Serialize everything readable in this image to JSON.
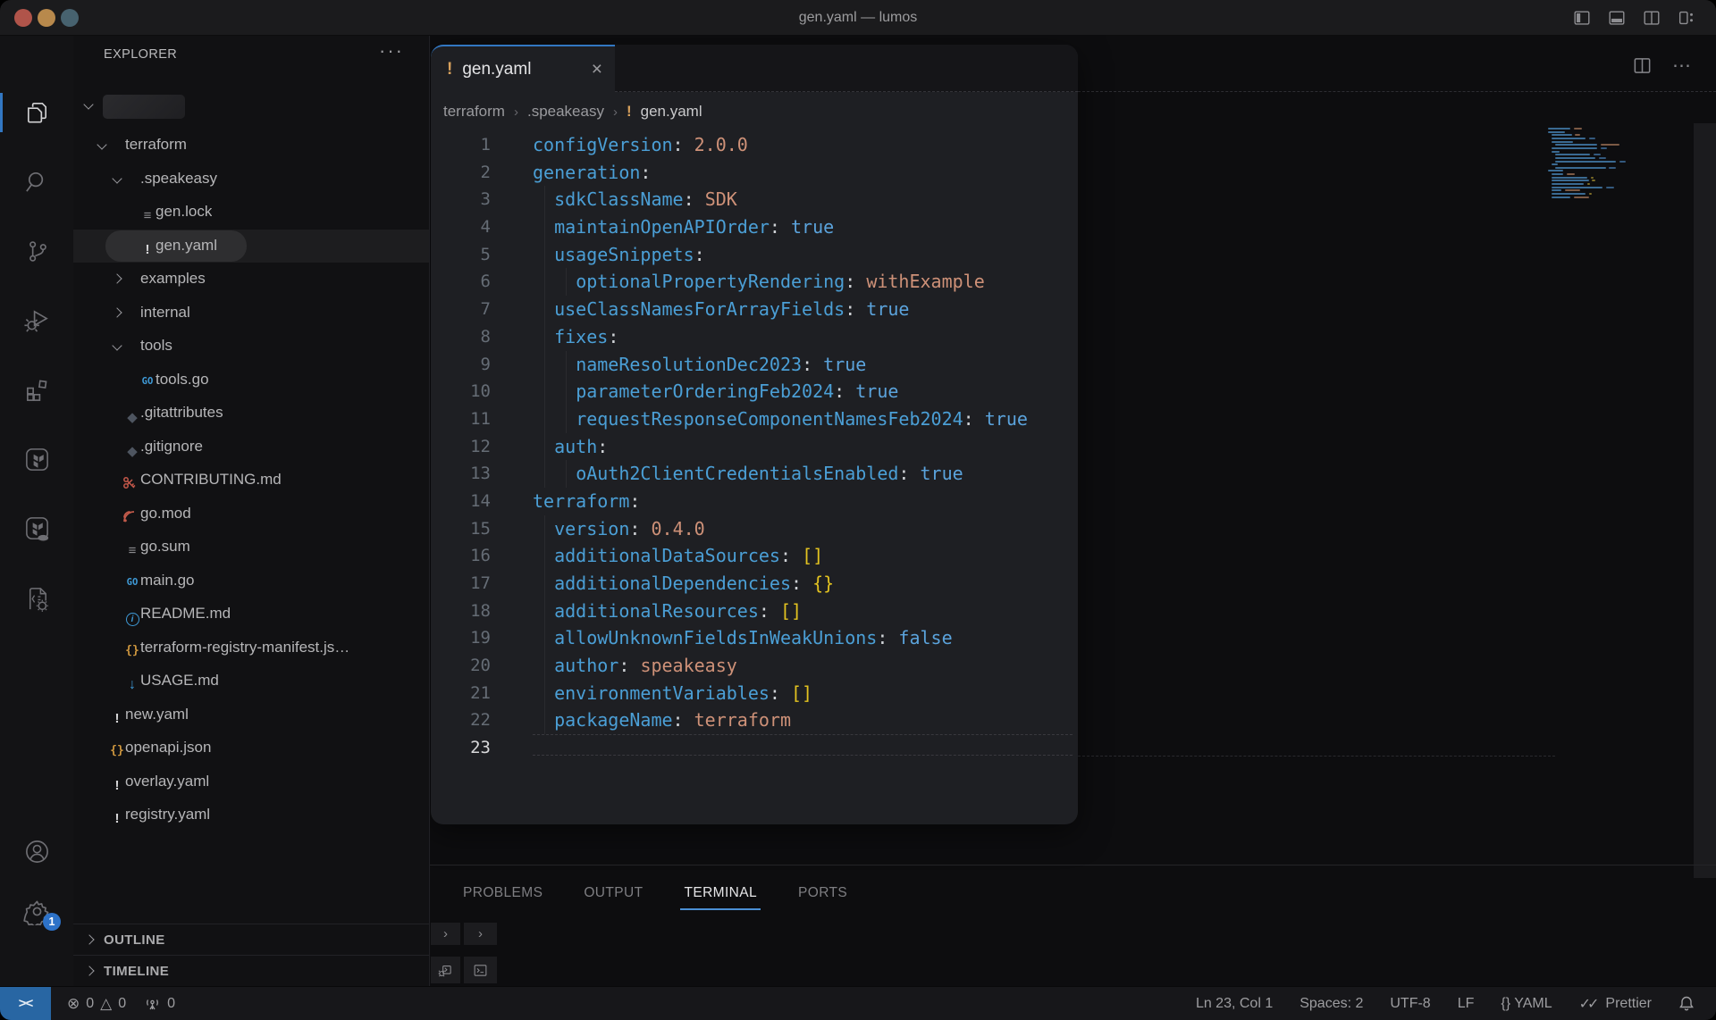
{
  "titlebar": {
    "title": "gen.yaml — lumos",
    "window_controls": [
      "toggle-primary-sidebar",
      "toggle-panel",
      "toggle-secondary-sidebar",
      "customize-layout"
    ]
  },
  "colors": {
    "accent_blue": "#3277c2",
    "traffic": [
      "#b0544a",
      "#b8894c",
      "#47626f"
    ],
    "yaml_key": "#4b9fd6",
    "yaml_string": "#ce9178",
    "yaml_bool": "#5ba3dc",
    "yaml_bracket": "#e2c220",
    "remote_bg": "#2866a3"
  },
  "activity_bar": {
    "top": [
      {
        "name": "explorer",
        "icon": "files",
        "active": true
      },
      {
        "name": "search",
        "icon": "search",
        "active": false
      },
      {
        "name": "source-control",
        "icon": "source-control",
        "active": false
      },
      {
        "name": "run-and-debug",
        "icon": "run-debug",
        "active": false
      },
      {
        "name": "extensions",
        "icon": "extensions",
        "active": false
      },
      {
        "name": "terraform",
        "icon": "terraform",
        "active": false
      },
      {
        "name": "terraform-cloud",
        "icon": "terraform-cloud",
        "active": false
      },
      {
        "name": "code-tools",
        "icon": "tools-file",
        "active": false
      }
    ],
    "bottom": [
      {
        "name": "accounts",
        "icon": "account"
      },
      {
        "name": "settings",
        "icon": "gear",
        "badge": "1"
      }
    ]
  },
  "sidebar": {
    "header": "EXPLORER",
    "more_actions": "···",
    "workspace_redacted": true,
    "tree": [
      {
        "label": "terraform",
        "type": "folder",
        "depth": 0,
        "expanded": true
      },
      {
        "label": ".speakeasy",
        "type": "folder",
        "depth": 1,
        "expanded": true
      },
      {
        "label": "gen.lock",
        "icon": "list",
        "depth": 2
      },
      {
        "label": "gen.yaml",
        "icon": "warn",
        "depth": 2,
        "selected": true
      },
      {
        "label": "examples",
        "type": "folder",
        "depth": 1,
        "expanded": false
      },
      {
        "label": "internal",
        "type": "folder",
        "depth": 1,
        "expanded": false
      },
      {
        "label": "tools",
        "type": "folder",
        "depth": 1,
        "expanded": true
      },
      {
        "label": "tools.go",
        "icon": "go",
        "depth": 2
      },
      {
        "label": ".gitattributes",
        "icon": "git",
        "depth": 1
      },
      {
        "label": ".gitignore",
        "icon": "git",
        "depth": 1
      },
      {
        "label": "CONTRIBUTING.md",
        "icon": "contributing",
        "depth": 1
      },
      {
        "label": "go.mod",
        "icon": "gomod",
        "depth": 1
      },
      {
        "label": "go.sum",
        "icon": "list",
        "depth": 1
      },
      {
        "label": "main.go",
        "icon": "go",
        "depth": 1
      },
      {
        "label": "README.md",
        "icon": "info",
        "depth": 1
      },
      {
        "label": "terraform-registry-manifest.js…",
        "icon": "braces",
        "depth": 1
      },
      {
        "label": "USAGE.md",
        "icon": "download",
        "depth": 1
      },
      {
        "label": "new.yaml",
        "icon": "warn",
        "depth": 0
      },
      {
        "label": "openapi.json",
        "icon": "braces",
        "depth": 0
      },
      {
        "label": "overlay.yaml",
        "icon": "warn",
        "depth": 0
      },
      {
        "label": "registry.yaml",
        "icon": "warn",
        "depth": 0
      }
    ],
    "sections": [
      "OUTLINE",
      "TIMELINE"
    ]
  },
  "editor": {
    "tab": {
      "label": "gen.yaml",
      "modified_icon": "!",
      "close": "×"
    },
    "breadcrumbs": [
      "terraform",
      ".speakeasy",
      "gen.yaml"
    ],
    "actions": [
      "split-editor",
      "more-actions"
    ],
    "code": [
      {
        "n": 1,
        "indent": 0,
        "key": "configVersion",
        "sep": ": ",
        "value": "2.0.0",
        "vtype": "str"
      },
      {
        "n": 2,
        "indent": 0,
        "key": "generation",
        "sep": ":"
      },
      {
        "n": 3,
        "indent": 2,
        "key": "sdkClassName",
        "sep": ": ",
        "value": "SDK",
        "vtype": "str"
      },
      {
        "n": 4,
        "indent": 2,
        "key": "maintainOpenAPIOrder",
        "sep": ": ",
        "value": "true",
        "vtype": "bool"
      },
      {
        "n": 5,
        "indent": 2,
        "key": "usageSnippets",
        "sep": ":"
      },
      {
        "n": 6,
        "indent": 4,
        "key": "optionalPropertyRendering",
        "sep": ": ",
        "value": "withExample",
        "vtype": "str"
      },
      {
        "n": 7,
        "indent": 2,
        "key": "useClassNamesForArrayFields",
        "sep": ": ",
        "value": "true",
        "vtype": "bool"
      },
      {
        "n": 8,
        "indent": 2,
        "key": "fixes",
        "sep": ":"
      },
      {
        "n": 9,
        "indent": 4,
        "key": "nameResolutionDec2023",
        "sep": ": ",
        "value": "true",
        "vtype": "bool"
      },
      {
        "n": 10,
        "indent": 4,
        "key": "parameterOrderingFeb2024",
        "sep": ": ",
        "value": "true",
        "vtype": "bool"
      },
      {
        "n": 11,
        "indent": 4,
        "key": "requestResponseComponentNamesFeb2024",
        "sep": ": ",
        "value": "true",
        "vtype": "bool"
      },
      {
        "n": 12,
        "indent": 2,
        "key": "auth",
        "sep": ":"
      },
      {
        "n": 13,
        "indent": 4,
        "key": "oAuth2ClientCredentialsEnabled",
        "sep": ": ",
        "value": "true",
        "vtype": "bool"
      },
      {
        "n": 14,
        "indent": 0,
        "key": "terraform",
        "sep": ":"
      },
      {
        "n": 15,
        "indent": 2,
        "key": "version",
        "sep": ": ",
        "value": "0.4.0",
        "vtype": "str"
      },
      {
        "n": 16,
        "indent": 2,
        "key": "additionalDataSources",
        "sep": ": ",
        "value": "[]",
        "vtype": "bracket"
      },
      {
        "n": 17,
        "indent": 2,
        "key": "additionalDependencies",
        "sep": ": ",
        "value": "{}",
        "vtype": "bracket"
      },
      {
        "n": 18,
        "indent": 2,
        "key": "additionalResources",
        "sep": ": ",
        "value": "[]",
        "vtype": "bracket"
      },
      {
        "n": 19,
        "indent": 2,
        "key": "allowUnknownFieldsInWeakUnions",
        "sep": ": ",
        "value": "false",
        "vtype": "bool"
      },
      {
        "n": 20,
        "indent": 2,
        "key": "author",
        "sep": ": ",
        "value": "speakeasy",
        "vtype": "str"
      },
      {
        "n": 21,
        "indent": 2,
        "key": "environmentVariables",
        "sep": ": ",
        "value": "[]",
        "vtype": "bracket"
      },
      {
        "n": 22,
        "indent": 2,
        "key": "packageName",
        "sep": ": ",
        "value": "terraform",
        "vtype": "str"
      },
      {
        "n": 23,
        "indent": 0,
        "key": "",
        "sep": "",
        "active": true
      }
    ]
  },
  "panel": {
    "tabs": [
      {
        "label": "PROBLEMS",
        "active": false
      },
      {
        "label": "OUTPUT",
        "active": false
      },
      {
        "label": "TERMINAL",
        "active": true
      },
      {
        "label": "PORTS",
        "active": false
      }
    ]
  },
  "status_bar": {
    "remote_glyph": "><",
    "errors": "0",
    "warnings": "0",
    "ports_count": "0",
    "cursor": "Ln 23, Col 1",
    "indentation": "Spaces: 2",
    "encoding": "UTF-8",
    "eol": "LF",
    "language": "{} YAML",
    "formatter": "Prettier"
  }
}
